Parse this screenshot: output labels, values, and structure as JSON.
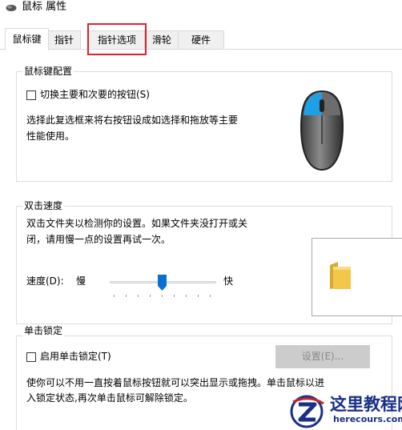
{
  "window": {
    "title": "鼠标 属性",
    "title_icon": "mouse-icon"
  },
  "tabs": [
    {
      "label": "鼠标键",
      "active": true
    },
    {
      "label": "指针",
      "active": false
    },
    {
      "label": "指针选项",
      "active": false
    },
    {
      "label": "滑轮",
      "active": false
    },
    {
      "label": "硬件",
      "active": false
    }
  ],
  "button_config": {
    "legend": "鼠标键配置",
    "swap_checkbox_label": "切换主要和次要的按钮(S)",
    "swap_checked": false,
    "description_line1": "选择此复选框来将右按钮设成如选择和拖放等主要",
    "description_line2": "性能使用。"
  },
  "double_click": {
    "legend": "双击速度",
    "description_line1": "双击文件夹以检测你的设置。如果文件夹没打开或关",
    "description_line2": "闭，请用慢一点的设置再试一次。",
    "speed_label": "速度(D):",
    "slow_label": "慢",
    "fast_label": "快",
    "speed_value_fraction": 0.5
  },
  "click_lock": {
    "legend": "单击锁定",
    "checkbox_label": "启用单击锁定(T)",
    "checked": false,
    "settings_button": "设置(E)...",
    "settings_enabled": false,
    "description_line1": "使你可以不用一直按着鼠标按钮就可以突出显示或拖拽。单击鼠标以进",
    "description_line2": "入锁定状态,再次单击鼠标可解除锁定。"
  },
  "watermark": {
    "title": "这里教程网",
    "url": "herecours.com"
  },
  "colors": {
    "highlight": "#e0202a",
    "mouse_accent": "#1ea0e6",
    "folder": "#f2c84b",
    "watermark": "#1a2f86"
  }
}
